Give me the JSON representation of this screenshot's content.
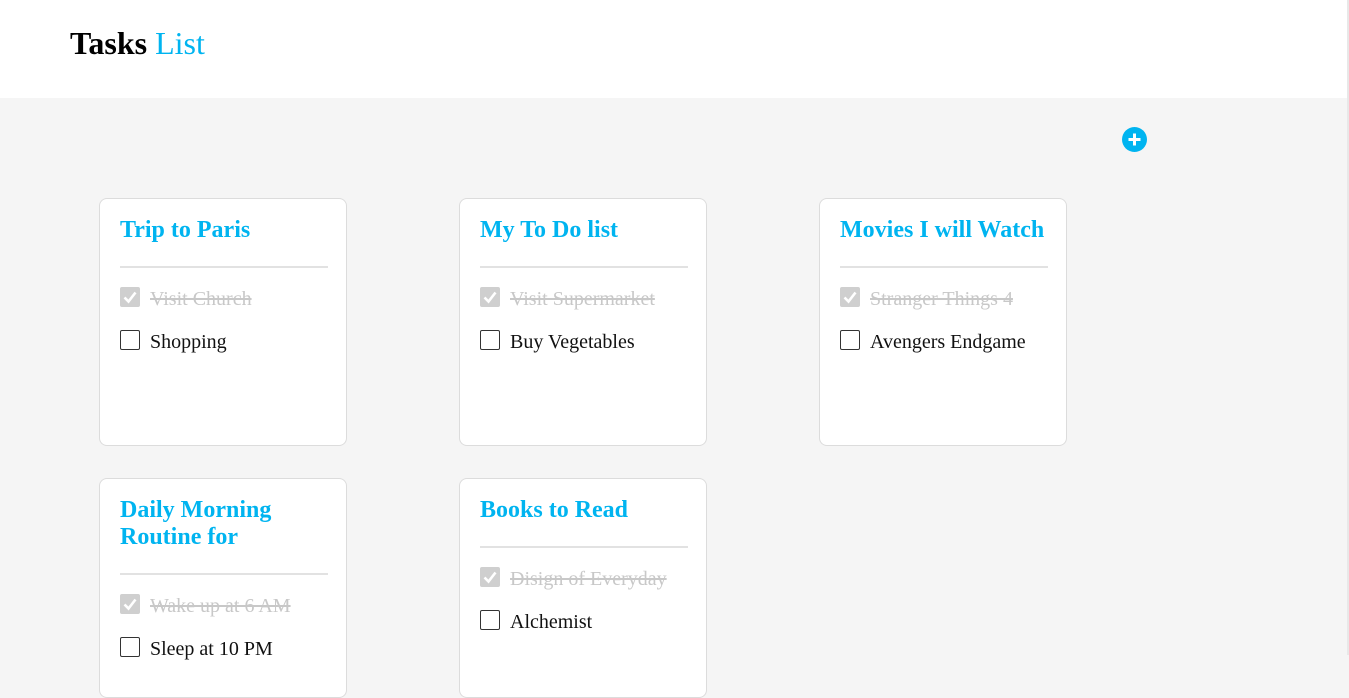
{
  "header": {
    "title_part1": "Tasks",
    "title_part2": "List"
  },
  "add_button": {
    "icon": "plus-circle-icon"
  },
  "colors": {
    "accent": "#00b4f0",
    "background": "#f5f5f5",
    "card": "#ffffff",
    "done_text": "#c8c8c8"
  },
  "cards": [
    {
      "title": "Trip to Paris",
      "tasks": [
        {
          "label": "Visit Church",
          "done": true
        },
        {
          "label": "Shopping",
          "done": false
        }
      ]
    },
    {
      "title": "My To Do list",
      "tasks": [
        {
          "label": "Visit Supermarket",
          "done": true
        },
        {
          "label": "Buy Vegetables",
          "done": false
        }
      ]
    },
    {
      "title": "Movies I will Watch",
      "tasks": [
        {
          "label": "Stranger Things 4",
          "done": true
        },
        {
          "label": "Avengers Endgame",
          "done": false
        }
      ]
    },
    {
      "title": "Daily Morning Routine for",
      "tasks": [
        {
          "label": "Wake up at 6 AM",
          "done": true
        },
        {
          "label": "Sleep at 10 PM",
          "done": false
        }
      ]
    },
    {
      "title": "Books to Read",
      "tasks": [
        {
          "label": "Disign of Everyday",
          "done": true
        },
        {
          "label": "Alchemist",
          "done": false
        }
      ]
    }
  ]
}
